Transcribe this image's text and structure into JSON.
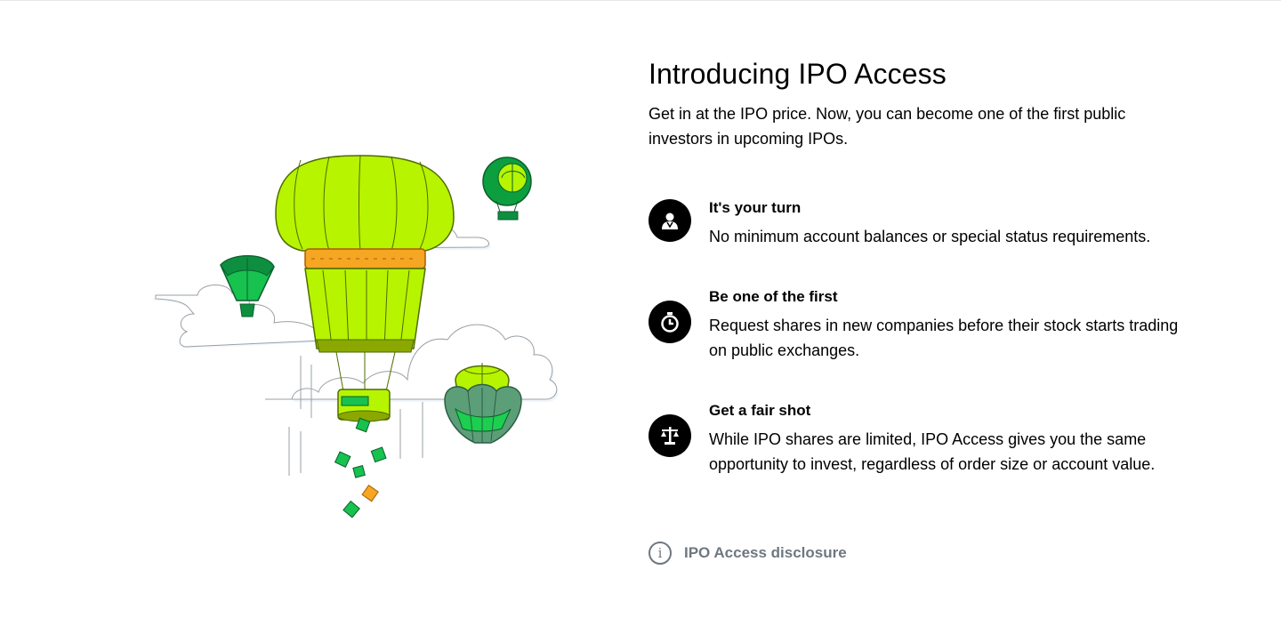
{
  "header": {
    "title": "Introducing IPO Access",
    "subtitle": "Get in at the IPO price. Now, you can become one of the first public investors in upcoming IPOs."
  },
  "features": [
    {
      "icon": "person-icon",
      "title": "It's your turn",
      "description": "No minimum account balances or special status requirements."
    },
    {
      "icon": "stopwatch-icon",
      "title": "Be one of the first",
      "description": "Request shares in new companies before their stock starts trading on public exchanges."
    },
    {
      "icon": "scales-icon",
      "title": "Get a fair shot",
      "description": "While IPO shares are limited, IPO Access gives you the same opportunity to invest, regardless of order size or account value."
    }
  ],
  "disclosure": {
    "icon": "info-icon",
    "label": "IPO Access disclosure"
  },
  "colors": {
    "lime": "#b7f400",
    "dark_green": "#0d8f3f",
    "bright_green": "#1ccf4f",
    "orange": "#f5a623",
    "muted_gray": "#6f7780"
  }
}
